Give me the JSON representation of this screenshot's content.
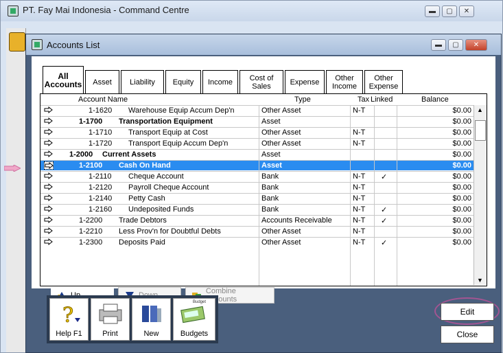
{
  "outer_window": {
    "title": "PT. Fay Mai Indonesia - Command Centre"
  },
  "window": {
    "title": "Accounts List"
  },
  "tabs": [
    {
      "label": "All Accounts",
      "active": true
    },
    {
      "label": "Asset"
    },
    {
      "label": "Liability"
    },
    {
      "label": "Equity"
    },
    {
      "label": "Income"
    },
    {
      "label": "Cost of Sales"
    },
    {
      "label": "Expense"
    },
    {
      "label": "Other Income"
    },
    {
      "label": "Other Expense"
    }
  ],
  "columns": {
    "name": "Account Name",
    "type": "Type",
    "tax": "Tax",
    "linked": "Linked",
    "balance": "Balance"
  },
  "rows": [
    {
      "num": "1-1620",
      "name": "Warehouse Equip Accum Dep'n",
      "type": "Other Asset",
      "tax": "N-T",
      "linked": "",
      "balance": "$0.00",
      "level": 2
    },
    {
      "num": "1-1700",
      "name": "Transportation Equipment",
      "type": "Asset",
      "tax": "",
      "linked": "",
      "balance": "$0.00",
      "level": 1,
      "bold": true
    },
    {
      "num": "1-1710",
      "name": "Transport Equip at Cost",
      "type": "Other Asset",
      "tax": "N-T",
      "linked": "",
      "balance": "$0.00",
      "level": 2
    },
    {
      "num": "1-1720",
      "name": "Transport Equip Accum Dep'n",
      "type": "Other Asset",
      "tax": "N-T",
      "linked": "",
      "balance": "$0.00",
      "level": 2
    },
    {
      "num": "1-2000",
      "name": "Current Assets",
      "type": "Asset",
      "tax": "",
      "linked": "",
      "balance": "$0.00",
      "level": 0,
      "bold": true
    },
    {
      "num": "1-2100",
      "name": "Cash On Hand",
      "type": "Asset",
      "tax": "",
      "linked": "",
      "balance": "$0.00",
      "level": 1,
      "bold": true,
      "selected": true
    },
    {
      "num": "1-2110",
      "name": "Cheque Account",
      "type": "Bank",
      "tax": "N-T",
      "linked": "✓",
      "balance": "$0.00",
      "level": 2
    },
    {
      "num": "1-2120",
      "name": "Payroll Cheque Account",
      "type": "Bank",
      "tax": "N-T",
      "linked": "",
      "balance": "$0.00",
      "level": 2
    },
    {
      "num": "1-2140",
      "name": "Petty Cash",
      "type": "Bank",
      "tax": "N-T",
      "linked": "",
      "balance": "$0.00",
      "level": 2
    },
    {
      "num": "1-2160",
      "name": "Undeposited Funds",
      "type": "Bank",
      "tax": "N-T",
      "linked": "✓",
      "balance": "$0.00",
      "level": 2
    },
    {
      "num": "1-2200",
      "name": "Trade Debtors",
      "type": "Accounts Receivable",
      "tax": "N-T",
      "linked": "✓",
      "balance": "$0.00",
      "level": 1
    },
    {
      "num": "1-2210",
      "name": "Less Prov'n for Doubtful Debts",
      "type": "Other Asset",
      "tax": "N-T",
      "linked": "",
      "balance": "$0.00",
      "level": 1
    },
    {
      "num": "1-2300",
      "name": "Deposits Paid",
      "type": "Other Asset",
      "tax": "N-T",
      "linked": "✓",
      "balance": "$0.00",
      "level": 1
    }
  ],
  "panel_buttons": {
    "up": "Up",
    "down": "Down",
    "combine": "Combine Accounts"
  },
  "toolbar": {
    "help": "Help F1",
    "print": "Print",
    "new": "New",
    "budgets": "Budgets",
    "budget_badge": "Budget"
  },
  "actions": {
    "edit": "Edit",
    "close": "Close"
  }
}
